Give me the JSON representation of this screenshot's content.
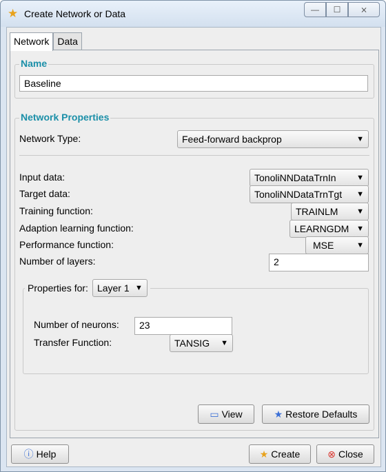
{
  "window": {
    "title": "Create Network or Data",
    "title_icon": "star-icon",
    "controls": {
      "minimize": "—",
      "maximize": "☐",
      "close": "⨯"
    }
  },
  "tabs": [
    {
      "label": "Network",
      "active": true
    },
    {
      "label": "Data",
      "active": false
    }
  ],
  "name_group": {
    "legend": "Name",
    "value": "Baseline"
  },
  "network_properties": {
    "legend": "Network Properties",
    "network_type_label": "Network Type:",
    "network_type_value": "Feed-forward backprop",
    "input_data_label": "Input data:",
    "input_data_value": "TonoliNNDataTrnIn",
    "target_data_label": "Target data:",
    "target_data_value": "TonoliNNDataTrnTgt",
    "training_function_label": "Training function:",
    "training_function_value": "TRAINLM",
    "adaption_label": "Adaption learning function:",
    "adaption_value": "LEARNGDM",
    "performance_label": "Performance function:",
    "performance_value": "MSE",
    "layers_label": "Number of layers:",
    "layers_value": "2"
  },
  "layer_properties": {
    "properties_for_label": "Properties for:",
    "layer_value": "Layer 1",
    "neurons_label": "Number of neurons:",
    "neurons_value": "23",
    "transfer_label": "Transfer Function:",
    "transfer_value": "TANSIG"
  },
  "buttons": {
    "view": "View",
    "restore_defaults": "Restore Defaults",
    "help": "Help",
    "create": "Create",
    "close": "Close"
  },
  "colors": {
    "accent": "#1b8fa8",
    "close_icon": "#d9322b",
    "help_icon": "#3b6fd6",
    "restore_icon": "#3b6fd6",
    "create_icon": "#e8a21c"
  }
}
